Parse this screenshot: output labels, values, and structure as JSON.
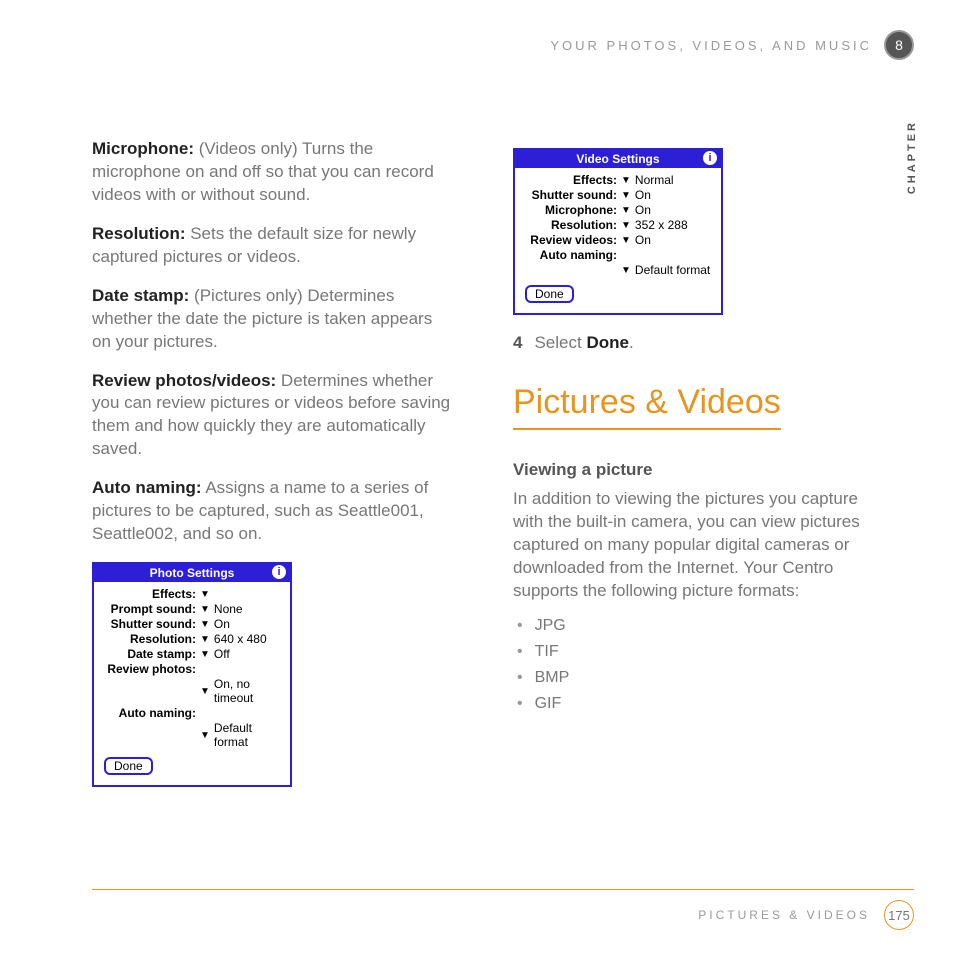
{
  "header": {
    "title": "YOUR PHOTOS, VIDEOS, AND MUSIC",
    "chapter_num": "8",
    "chapter_label": "CHAPTER"
  },
  "left": {
    "p1": {
      "label": "Microphone:",
      "text": " (Videos only) Turns the microphone on and off so that you can record videos with or without sound."
    },
    "p2": {
      "label": "Resolution:",
      "text": " Sets the default size for newly captured pictures or videos."
    },
    "p3": {
      "label": "Date stamp:",
      "text": " (Pictures only) Determines whether the date the picture is taken appears on your pictures."
    },
    "p4": {
      "label": "Review photos/videos:",
      "text": " Determines whether you can review pictures or videos before saving them and how quickly they are automatically saved."
    },
    "p5": {
      "label": "Auto naming:",
      "text": " Assigns a name to a series of pictures to be captured, such as Seattle001, Seattle002, and so on."
    }
  },
  "photo_settings": {
    "title": "Photo Settings",
    "rows": {
      "effects": "Effects:",
      "prompt_sound_l": "Prompt sound:",
      "prompt_sound_v": "None",
      "shutter_l": "Shutter sound:",
      "shutter_v": "On",
      "resolution_l": "Resolution:",
      "resolution_v": "640 x 480",
      "date_l": "Date stamp:",
      "date_v": "Off",
      "review_l": "Review photos:",
      "review_v": "On, no timeout",
      "auto_l": "Auto naming:",
      "auto_v": "Default format"
    },
    "done": "Done"
  },
  "video_settings": {
    "title": "Video Settings",
    "rows": {
      "effects_l": "Effects:",
      "effects_v": "Normal",
      "shutter_l": "Shutter sound:",
      "shutter_v": "On",
      "mic_l": "Microphone:",
      "mic_v": "On",
      "res_l": "Resolution:",
      "res_v": "352 x 288",
      "review_l": "Review videos:",
      "review_v": "On",
      "auto_l": "Auto naming:",
      "auto_v": "Default format"
    },
    "done": "Done"
  },
  "step4": {
    "num": "4",
    "pre": "Select ",
    "bold": "Done",
    "post": "."
  },
  "section": {
    "title": "Pictures & Videos",
    "subhead": "Viewing a picture",
    "body": "In addition to viewing the pictures you capture with the built-in camera, you can view pictures captured on many popular digital cameras or downloaded from the Internet. Your Centro supports the following picture formats:",
    "formats": [
      "JPG",
      "TIF",
      "BMP",
      "GIF"
    ]
  },
  "footer": {
    "title": "PICTURES & VIDEOS",
    "page": "175"
  }
}
